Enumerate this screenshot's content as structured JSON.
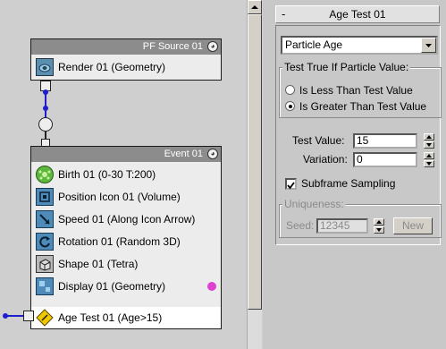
{
  "flow": {
    "source_node": {
      "title": "PF Source 01",
      "operators": [
        {
          "label": "Render 01 (Geometry)",
          "icon": "render-icon"
        }
      ]
    },
    "event_node": {
      "title": "Event 01",
      "operators": [
        {
          "label": "Birth 01 (0-30 T:200)",
          "icon": "birth-icon"
        },
        {
          "label": "Position Icon 01 (Volume)",
          "icon": "position-icon"
        },
        {
          "label": "Speed 01 (Along Icon Arrow)",
          "icon": "speed-icon"
        },
        {
          "label": "Rotation 01 (Random 3D)",
          "icon": "rotation-icon"
        },
        {
          "label": "Shape 01 (Tetra)",
          "icon": "shape-icon"
        },
        {
          "label": "Display 01 (Geometry)",
          "icon": "display-icon"
        },
        {
          "label": "Age Test 01 (Age>15)",
          "icon": "age-test-icon"
        }
      ]
    },
    "colors": {
      "wire": "#1e1ecc",
      "display_dot": "#e040d0",
      "test_icon": "#f0c800"
    }
  },
  "panel": {
    "rollout_collapse": "-",
    "rollout_title": "Age Test 01",
    "test_type": "Particle Age",
    "group_test_title": "Test True If Particle Value:",
    "radio_less": "Is Less Than Test Value",
    "radio_greater": "Is Greater Than Test Value",
    "selected_radio": "greater",
    "test_value_label": "Test Value:",
    "test_value": "15",
    "variation_label": "Variation:",
    "variation": "0",
    "subframe_label": "Subframe Sampling",
    "subframe_checked": true,
    "uniqueness_title": "Uniqueness:",
    "seed_label": "Seed:",
    "seed_value": "12345",
    "new_label": "New"
  }
}
